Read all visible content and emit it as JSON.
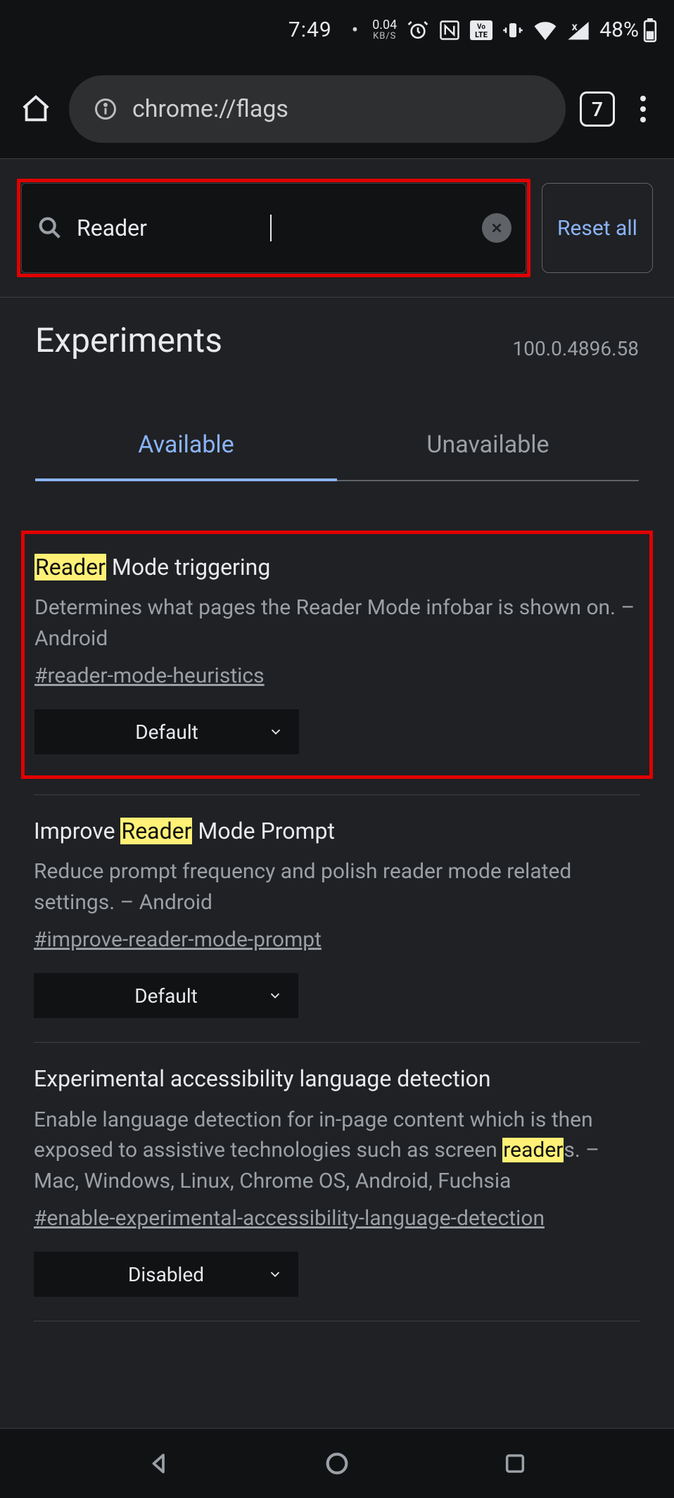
{
  "statusbar": {
    "time": "7:49",
    "net_speed_value": "0.04",
    "net_speed_unit": "KB/S",
    "battery_percent": "48%"
  },
  "chrome": {
    "url": "chrome://flags",
    "tab_count": "7"
  },
  "search": {
    "value": "Reader",
    "reset_label": "Reset all"
  },
  "header": {
    "title": "Experiments",
    "version": "100.0.4896.58"
  },
  "tabs": {
    "available": "Available",
    "unavailable": "Unavailable"
  },
  "flags": [
    {
      "title_prefix_hl": "Reader",
      "title_rest": " Mode triggering",
      "desc": "Determines what pages the Reader Mode infobar is shown on. – Android",
      "anchor": "#reader-mode-heuristics",
      "select_value": "Default"
    },
    {
      "title_before": "Improve ",
      "title_hl": "Reader",
      "title_after": " Mode Prompt",
      "desc": "Reduce prompt frequency and polish reader mode related settings. – Android",
      "anchor": "#improve-reader-mode-prompt",
      "select_value": "Default"
    },
    {
      "title_plain": "Experimental accessibility language detection",
      "desc_before": "Enable language detection for in-page content which is then exposed to assistive technologies such as screen ",
      "desc_hl": "reader",
      "desc_after": "s. – Mac, Windows, Linux, Chrome OS, Android, Fuchsia",
      "anchor": "#enable-experimental-accessibility-language-detection",
      "select_value": "Disabled"
    }
  ]
}
